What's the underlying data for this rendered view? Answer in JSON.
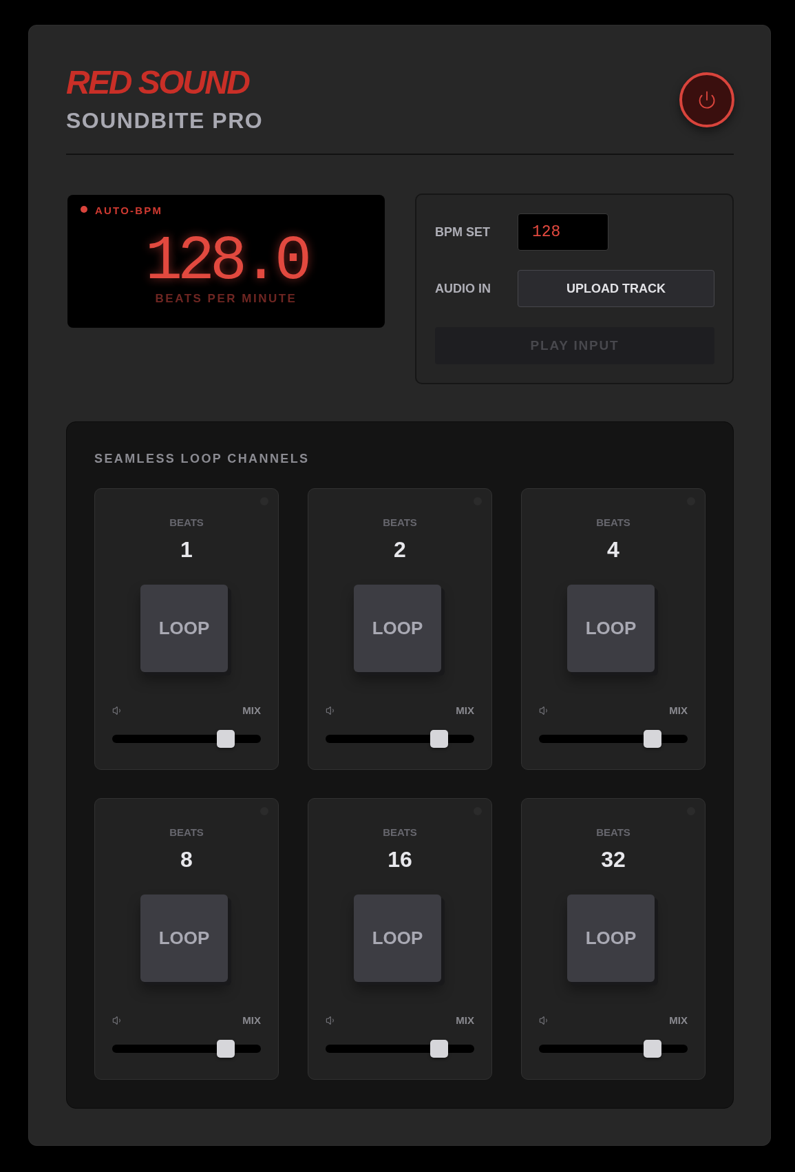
{
  "brand": {
    "logo": "RED SOUND",
    "model": "SOUNDBITE PRO"
  },
  "power": {
    "on": true
  },
  "display": {
    "indicator": {
      "label": "AUTO-BPM",
      "on": true
    },
    "reading": "128.0",
    "unit": "BEATS PER MINUTE"
  },
  "controls": {
    "bpm_label": "BPM SET",
    "bpm_value": "128",
    "audio_label": "AUDIO IN",
    "upload_button": "UPLOAD TRACK",
    "play": {
      "label": "PLAY INPUT",
      "disabled": true
    }
  },
  "loops": {
    "title": "SEAMLESS LOOP CHANNELS",
    "channels": [
      {
        "beats_label": "BEATS",
        "beats": "1",
        "button": "LOOP",
        "active": false,
        "mix_label": "MIX",
        "level": 0.8
      },
      {
        "beats_label": "BEATS",
        "beats": "2",
        "button": "LOOP",
        "active": false,
        "mix_label": "MIX",
        "level": 0.8
      },
      {
        "beats_label": "BEATS",
        "beats": "4",
        "button": "LOOP",
        "active": false,
        "mix_label": "MIX",
        "level": 0.8
      },
      {
        "beats_label": "BEATS",
        "beats": "8",
        "button": "LOOP",
        "active": false,
        "mix_label": "MIX",
        "level": 0.8
      },
      {
        "beats_label": "BEATS",
        "beats": "16",
        "button": "LOOP",
        "active": false,
        "mix_label": "MIX",
        "level": 0.8
      },
      {
        "beats_label": "BEATS",
        "beats": "32",
        "button": "LOOP",
        "active": false,
        "mix_label": "MIX",
        "level": 0.8
      }
    ]
  }
}
